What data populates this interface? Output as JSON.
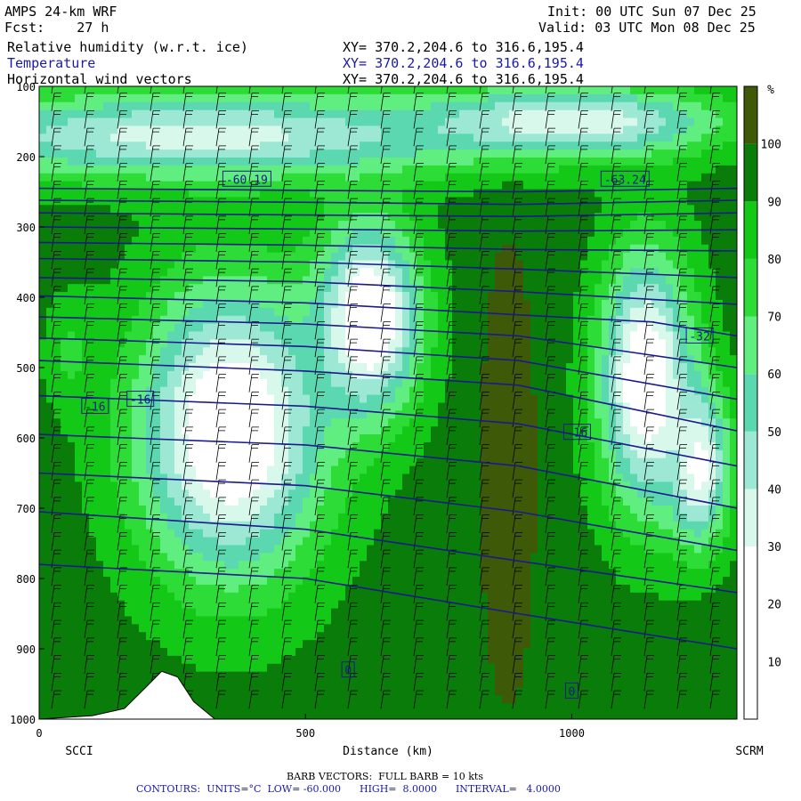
{
  "header": {
    "model": "AMPS 24-km WRF",
    "fcst": "Fcst:    27 h",
    "init": "Init: 00 UTC Sun 07 Dec 25",
    "valid": "Valid: 03 UTC Mon 08 Dec 25",
    "fields": [
      {
        "label": "Relative humidity (w.r.t. ice)",
        "xy": "XY= 370.2,204.6 to 316.6,195.4"
      },
      {
        "label": "Temperature",
        "xy": "XY= 370.2,204.6 to 316.6,195.4"
      },
      {
        "label": "Horizontal wind vectors",
        "xy": "XY= 370.2,204.6 to 316.6,195.4"
      }
    ]
  },
  "footer": {
    "barb_note": "BARB VECTORS:  FULL BARB = 10 kts",
    "contour_note": "CONTOURS:  UNITS=°C  LOW= -60.000      HIGH=  8.0000      INTERVAL=   4.0000"
  },
  "chart_data": {
    "type": "heatmap",
    "xlabel": "Distance (km)",
    "ylabel": "",
    "xlim": [
      0,
      1310
    ],
    "ylim": [
      1000,
      100
    ],
    "x_ticks": [
      0,
      500,
      1000
    ],
    "y_ticks": [
      100,
      200,
      300,
      400,
      500,
      600,
      700,
      800,
      900,
      1000
    ],
    "endpoints": {
      "left": "SCCI",
      "right": "SCRM"
    },
    "colorbar": {
      "unit": "%",
      "bounds": [
        0,
        10,
        20,
        30,
        40,
        50,
        60,
        70,
        80,
        90,
        100,
        110
      ],
      "labels": [
        10,
        20,
        30,
        40,
        50,
        60,
        70,
        80,
        90,
        100
      ],
      "colors": [
        "#ffffff",
        "#ffffff",
        "#ffffff",
        "#d8f8ec",
        "#9ce8d4",
        "#5cd8b0",
        "#60ee80",
        "#2ddc36",
        "#14c818",
        "#0a7c0a",
        "#3e5a08"
      ]
    },
    "rh_field": {
      "background": 95,
      "blobs": [
        {
          "x": 360,
          "p": 590,
          "rx": 220,
          "rp": 260,
          "val": 12
        },
        {
          "x": 620,
          "p": 430,
          "rx": 120,
          "rp": 170,
          "val": 12
        },
        {
          "x": 1140,
          "p": 520,
          "rx": 110,
          "rp": 230,
          "val": 15
        },
        {
          "x": 1240,
          "p": 640,
          "rx": 70,
          "rp": 140,
          "val": 25
        },
        {
          "x": 60,
          "p": 480,
          "rx": 60,
          "rp": 100,
          "val": 78
        },
        {
          "x": 880,
          "p": 650,
          "rx": 60,
          "rp": 380,
          "val": 112
        },
        {
          "x": 300,
          "p": 170,
          "rx": 700,
          "rp": 80,
          "val": 35
        },
        {
          "x": 1000,
          "p": 150,
          "rx": 350,
          "rp": 60,
          "val": 30
        }
      ]
    },
    "temperature_contours": [
      {
        "value": -60,
        "points": [
          [
            0,
            245
          ],
          [
            500,
            248
          ],
          [
            900,
            250
          ],
          [
            1310,
            245
          ]
        ]
      },
      {
        "value": -56,
        "points": [
          [
            0,
            262
          ],
          [
            500,
            265
          ],
          [
            900,
            268
          ],
          [
            1310,
            262
          ]
        ]
      },
      {
        "value": -52,
        "points": [
          [
            0,
            280
          ],
          [
            500,
            283
          ],
          [
            900,
            285
          ],
          [
            1310,
            280
          ]
        ]
      },
      {
        "value": -48,
        "points": [
          [
            0,
            300
          ],
          [
            500,
            303
          ],
          [
            900,
            306
          ],
          [
            1310,
            304
          ]
        ]
      },
      {
        "value": -44,
        "points": [
          [
            0,
            322
          ],
          [
            500,
            326
          ],
          [
            900,
            332
          ],
          [
            1310,
            334
          ]
        ]
      },
      {
        "value": -40,
        "points": [
          [
            0,
            345
          ],
          [
            500,
            350
          ],
          [
            900,
            360
          ],
          [
            1310,
            372
          ]
        ]
      },
      {
        "value": -36,
        "points": [
          [
            0,
            372
          ],
          [
            500,
            378
          ],
          [
            900,
            392
          ],
          [
            1310,
            410
          ]
        ]
      },
      {
        "value": -32,
        "points": [
          [
            0,
            398
          ],
          [
            500,
            408
          ],
          [
            900,
            425
          ],
          [
            1150,
            435
          ],
          [
            1310,
            455
          ]
        ]
      },
      {
        "value": -28,
        "points": [
          [
            0,
            428
          ],
          [
            500,
            438
          ],
          [
            900,
            455
          ],
          [
            1310,
            500
          ]
        ]
      },
      {
        "value": -24,
        "points": [
          [
            0,
            458
          ],
          [
            500,
            470
          ],
          [
            900,
            490
          ],
          [
            1310,
            545
          ]
        ]
      },
      {
        "value": -20,
        "points": [
          [
            0,
            490
          ],
          [
            500,
            505
          ],
          [
            900,
            525
          ],
          [
            1310,
            590
          ]
        ]
      },
      {
        "value": -16,
        "points": [
          [
            0,
            540
          ],
          [
            500,
            555
          ],
          [
            900,
            580
          ],
          [
            1310,
            640
          ]
        ]
      },
      {
        "value": -12,
        "points": [
          [
            0,
            595
          ],
          [
            500,
            610
          ],
          [
            900,
            640
          ],
          [
            1310,
            700
          ]
        ]
      },
      {
        "value": -8,
        "points": [
          [
            0,
            650
          ],
          [
            500,
            668
          ],
          [
            900,
            705
          ],
          [
            1310,
            760
          ]
        ]
      },
      {
        "value": -4,
        "points": [
          [
            0,
            705
          ],
          [
            500,
            730
          ],
          [
            900,
            775
          ],
          [
            1310,
            820
          ]
        ]
      },
      {
        "value": 0,
        "points": [
          [
            0,
            780
          ],
          [
            500,
            800
          ],
          [
            900,
            850
          ],
          [
            1310,
            900
          ]
        ]
      }
    ],
    "contour_labels": [
      {
        "text": "-60.19",
        "x": 390,
        "p": 232
      },
      {
        "text": "-63.24",
        "x": 1100,
        "p": 232
      },
      {
        "text": "-32",
        "x": 1240,
        "p": 455
      },
      {
        "text": "-16",
        "x": 105,
        "p": 555
      },
      {
        "text": "-16",
        "x": 190,
        "p": 545
      },
      {
        "text": "-16",
        "x": 1010,
        "p": 592
      },
      {
        "text": "0",
        "x": 580,
        "p": 930
      },
      {
        "text": "0",
        "x": 1000,
        "p": 960
      }
    ],
    "terrain": [
      [
        0,
        1000
      ],
      [
        100,
        995
      ],
      [
        160,
        985
      ],
      [
        200,
        955
      ],
      [
        230,
        932
      ],
      [
        260,
        940
      ],
      [
        290,
        975
      ],
      [
        330,
        1000
      ]
    ],
    "wind_barbs": {
      "x_spacing": 37,
      "p_spacing": 25,
      "nominal_speed": 20,
      "nominal_direction": 270
    }
  }
}
